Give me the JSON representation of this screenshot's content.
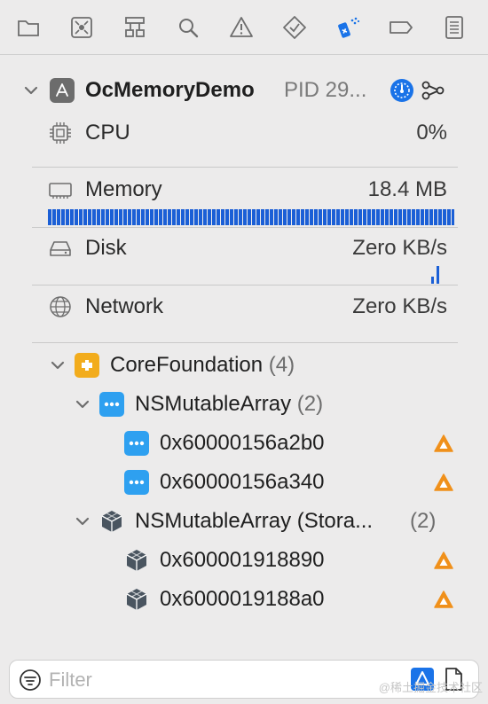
{
  "toolbar": {
    "buttons": [
      {
        "name": "folder-icon"
      },
      {
        "name": "source-control-icon"
      },
      {
        "name": "hierarchy-icon"
      },
      {
        "name": "search-icon"
      },
      {
        "name": "warning-icon"
      },
      {
        "name": "test-icon"
      },
      {
        "name": "debug-memory-icon",
        "active": true
      },
      {
        "name": "breakpoint-icon"
      },
      {
        "name": "report-icon"
      }
    ],
    "accent": "#1a73e8"
  },
  "process": {
    "name": "OcMemoryDemo",
    "pid": "PID 29..."
  },
  "metrics": {
    "cpu": {
      "label": "CPU",
      "value": "0%"
    },
    "memory": {
      "label": "Memory",
      "value": "18.4 MB"
    },
    "disk": {
      "label": "Disk",
      "value": "Zero KB/s"
    },
    "network": {
      "label": "Network",
      "value": "Zero KB/s"
    }
  },
  "tree": {
    "root": {
      "name": "CoreFoundation",
      "count": "(4)"
    },
    "groups": [
      {
        "name": "NSMutableArray",
        "count": "(2)",
        "items": [
          "0x60000156a2b0",
          "0x60000156a340"
        ]
      },
      {
        "name": "NSMutableArray (Stora...",
        "count": "(2)",
        "items": [
          "0x600001918890",
          "0x6000019188a0"
        ]
      }
    ]
  },
  "colors": {
    "warning": "#f0901a",
    "class_icon": "#2ea0f0",
    "framework_icon": "#f2ac1c",
    "storage_icon": "#4a5560"
  },
  "filter": {
    "placeholder": "Filter"
  },
  "watermark": "@稀土掘金技术社区"
}
